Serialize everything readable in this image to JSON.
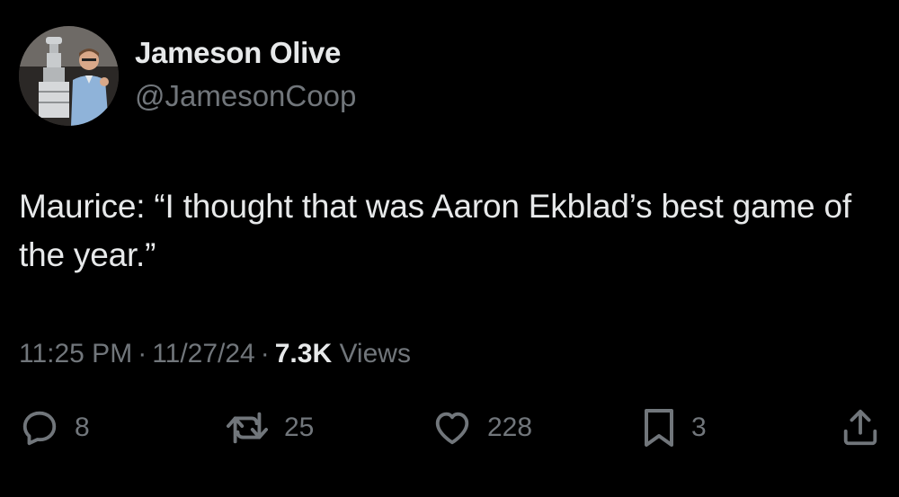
{
  "author": {
    "name": "Jameson Olive",
    "handle": "@JamesonCoop"
  },
  "tweet": {
    "text": "Maurice: “I thought that was Aaron Ekblad’s best game of the year.”",
    "time": "11:25 PM",
    "date": "11/27/24",
    "separator": "·",
    "views_count": "7.3K",
    "views_label": "Views"
  },
  "actions": {
    "replies": "8",
    "retweets": "25",
    "likes": "228",
    "bookmarks": "3"
  },
  "icons": {
    "reply": "reply-icon",
    "retweet": "retweet-icon",
    "like": "heart-icon",
    "bookmark": "bookmark-icon",
    "share": "share-icon"
  },
  "colors": {
    "background": "#000000",
    "primary_text": "#e7e9ea",
    "secondary_text": "#71767b"
  }
}
